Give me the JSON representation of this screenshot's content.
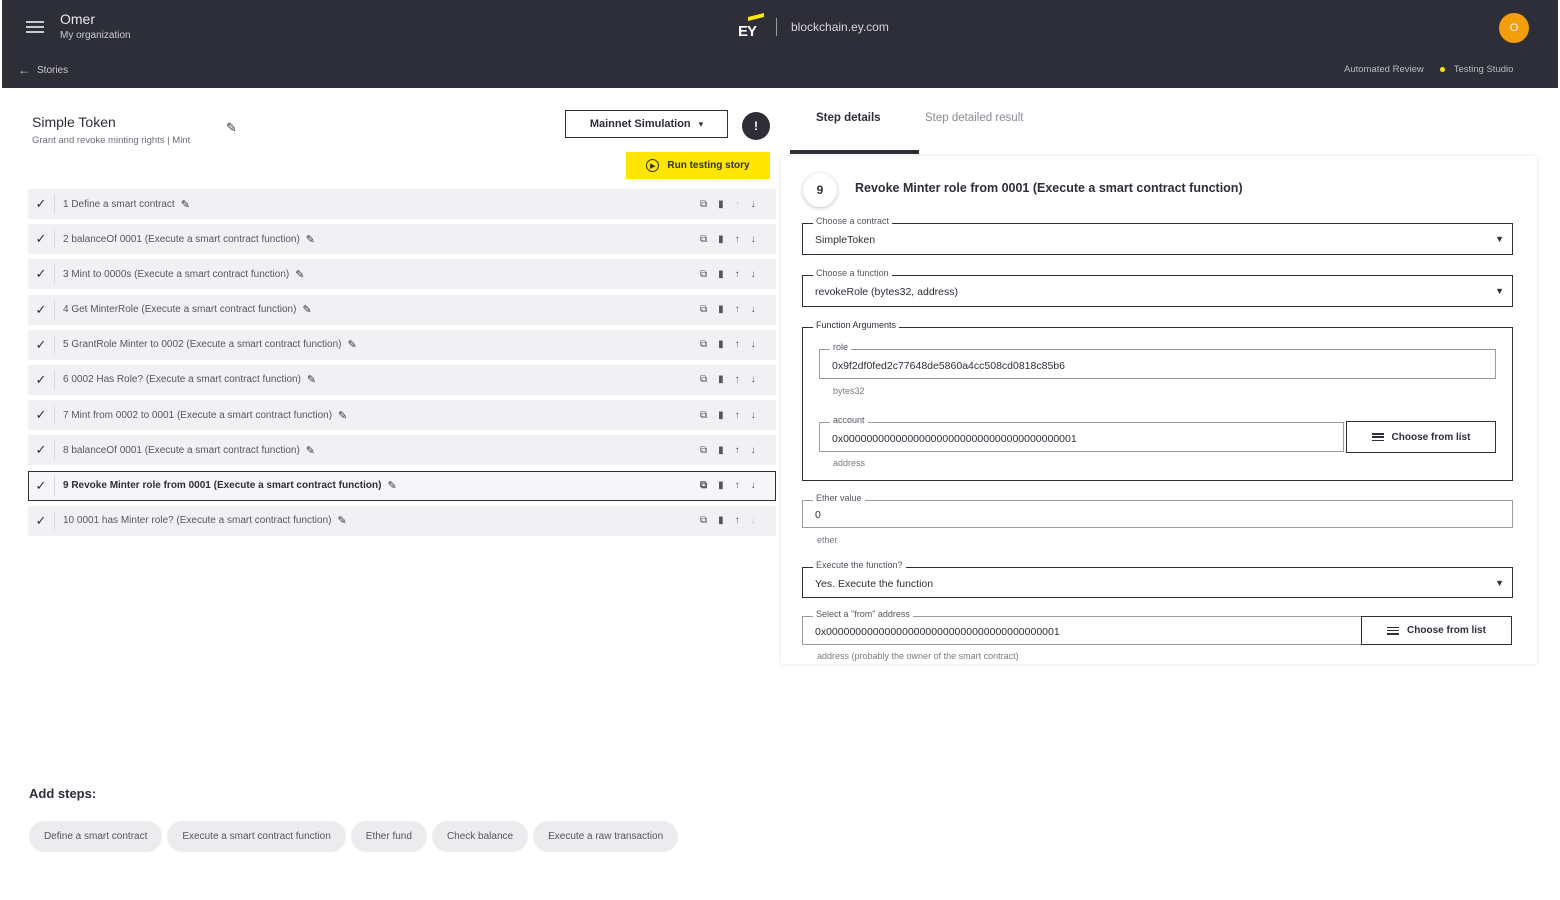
{
  "header": {
    "user_name": "Omer",
    "organization": "My organization",
    "brand_logo": "EY",
    "domain": "blockchain.ey.com",
    "avatar_initial": "O",
    "back_label": "Stories",
    "nav_automated_review": "Automated Review",
    "nav_testing_studio": "Testing Studio"
  },
  "story": {
    "title": "Simple Token",
    "subtitle": "Grant and revoke minting rights | Mint",
    "mode": "Mainnet Simulation",
    "info_icon": "!",
    "run_label": "Run testing story"
  },
  "steps": [
    {
      "label": "1  Define a smart contract"
    },
    {
      "label": "2  balanceOf 0001 (Execute a smart contract function)"
    },
    {
      "label": "3  Mint to 0000s (Execute a smart contract function)"
    },
    {
      "label": "4  Get MinterRole (Execute a smart contract function)"
    },
    {
      "label": "5  GrantRole Minter to 0002 (Execute a smart contract function)"
    },
    {
      "label": "6  0002 Has Role? (Execute a smart contract function)"
    },
    {
      "label": "7  Mint from 0002 to 0001 (Execute a smart contract function)"
    },
    {
      "label": "8  balanceOf 0001 (Execute a smart contract function)"
    },
    {
      "label": "9  Revoke Minter role from 0001 (Execute a smart contract function)"
    },
    {
      "label": "10  0001 has Minter role? (Execute a smart contract function)"
    }
  ],
  "active_step_index": 8,
  "add_steps": {
    "label": "Add steps:",
    "options": [
      "Define a smart contract",
      "Execute a smart contract function",
      "Ether fund",
      "Check balance",
      "Execute a raw transaction"
    ]
  },
  "tabs": {
    "details": "Step details",
    "result": "Step detailed result"
  },
  "details": {
    "step_number": "9",
    "title": "Revoke Minter role from 0001 (Execute a smart contract function)",
    "contract_label": "Choose a contract",
    "contract_value": "SimpleToken",
    "function_label": "Choose a function",
    "function_value": "revokeRole (bytes32, address)",
    "args_label": "Function Arguments",
    "role_label": "role",
    "role_value": "0x9f2df0fed2c77648de5860a4cc508cd0818c85b6",
    "role_type": "bytes32",
    "account_label": "account",
    "account_value": "0x0000000000000000000000000000000000000001",
    "account_type": "address",
    "choose_from_list": "Choose from list",
    "ether_label": "Ether value",
    "ether_value": "0",
    "ether_unit": "ether",
    "execute_label": "Execute the function?",
    "execute_value": "Yes. Execute the function",
    "from_label": "Select a \"from\" address",
    "from_value": "0x0000000000000000000000000000000000000001",
    "from_helper": "address (probably the owner of the smart contract)"
  },
  "colors": {
    "header_bg": "#2e2e38",
    "accent_yellow": "#ffe600",
    "avatar": "#f59e0b"
  }
}
